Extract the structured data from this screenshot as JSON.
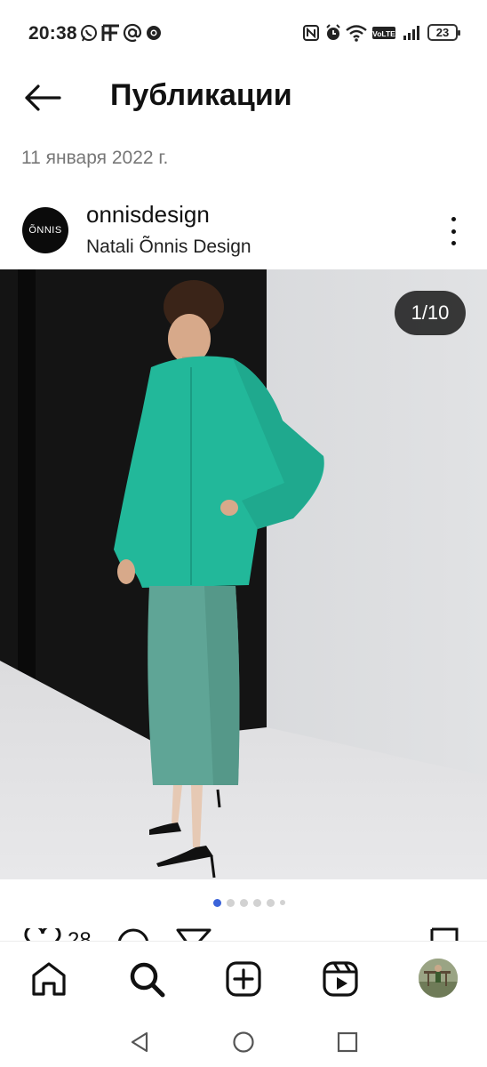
{
  "status_bar": {
    "time": "20:38",
    "battery_level": "23",
    "icons": [
      "whatsapp-icon",
      "ff-app-icon",
      "at-sign-icon",
      "chrome-icon",
      "nfc-icon",
      "alarm-icon",
      "wifi-icon",
      "volte-icon",
      "signal-icon",
      "battery-icon"
    ]
  },
  "header": {
    "title": "Публикации",
    "back_icon": "arrow-left-icon"
  },
  "date_label": "11 января 2022 г.",
  "post": {
    "username": "onnisdesign",
    "subtitle": "Natali Õnnis Design",
    "avatar_logo_text": "ÕNNIS",
    "media_counter": "1/10",
    "carousel_dots": 6,
    "active_dot": 0,
    "like_count_partial": "28"
  },
  "bottom_nav": {
    "items": [
      "home-icon",
      "search-icon",
      "create-post-icon",
      "reels-icon",
      "profile-avatar"
    ]
  },
  "system_nav": [
    "back-triangle-icon",
    "home-circle-icon",
    "recents-square-icon"
  ],
  "colors": {
    "accent_dot": "#3b63d9",
    "coat": "#22b89a",
    "skirt": "#5fa596",
    "background_wall": "#d9dadc",
    "dark_panel": "#141414"
  }
}
